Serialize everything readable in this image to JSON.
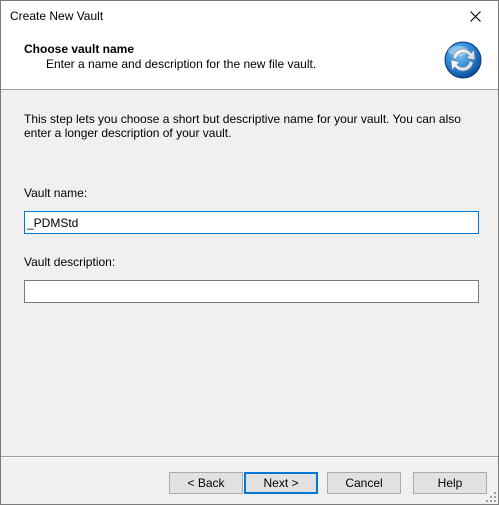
{
  "window": {
    "title": "Create New Vault"
  },
  "header": {
    "title": "Choose vault name",
    "subtitle": "Enter a name and description for the new file vault.",
    "icon": "vault-sync-icon"
  },
  "body": {
    "intro": "This step lets you choose a short but descriptive name for your vault. You can also enter a longer description of your vault.",
    "vault_name_label": "Vault name:",
    "vault_name_value": "_PDMStd",
    "vault_description_label": "Vault description:",
    "vault_description_value": ""
  },
  "buttons": {
    "back": "< Back",
    "next": "Next >",
    "cancel": "Cancel",
    "help": "Help"
  },
  "colors": {
    "accent": "#0078d7",
    "dialog_bg": "#f0f0f0",
    "header_bg": "#ffffff"
  }
}
